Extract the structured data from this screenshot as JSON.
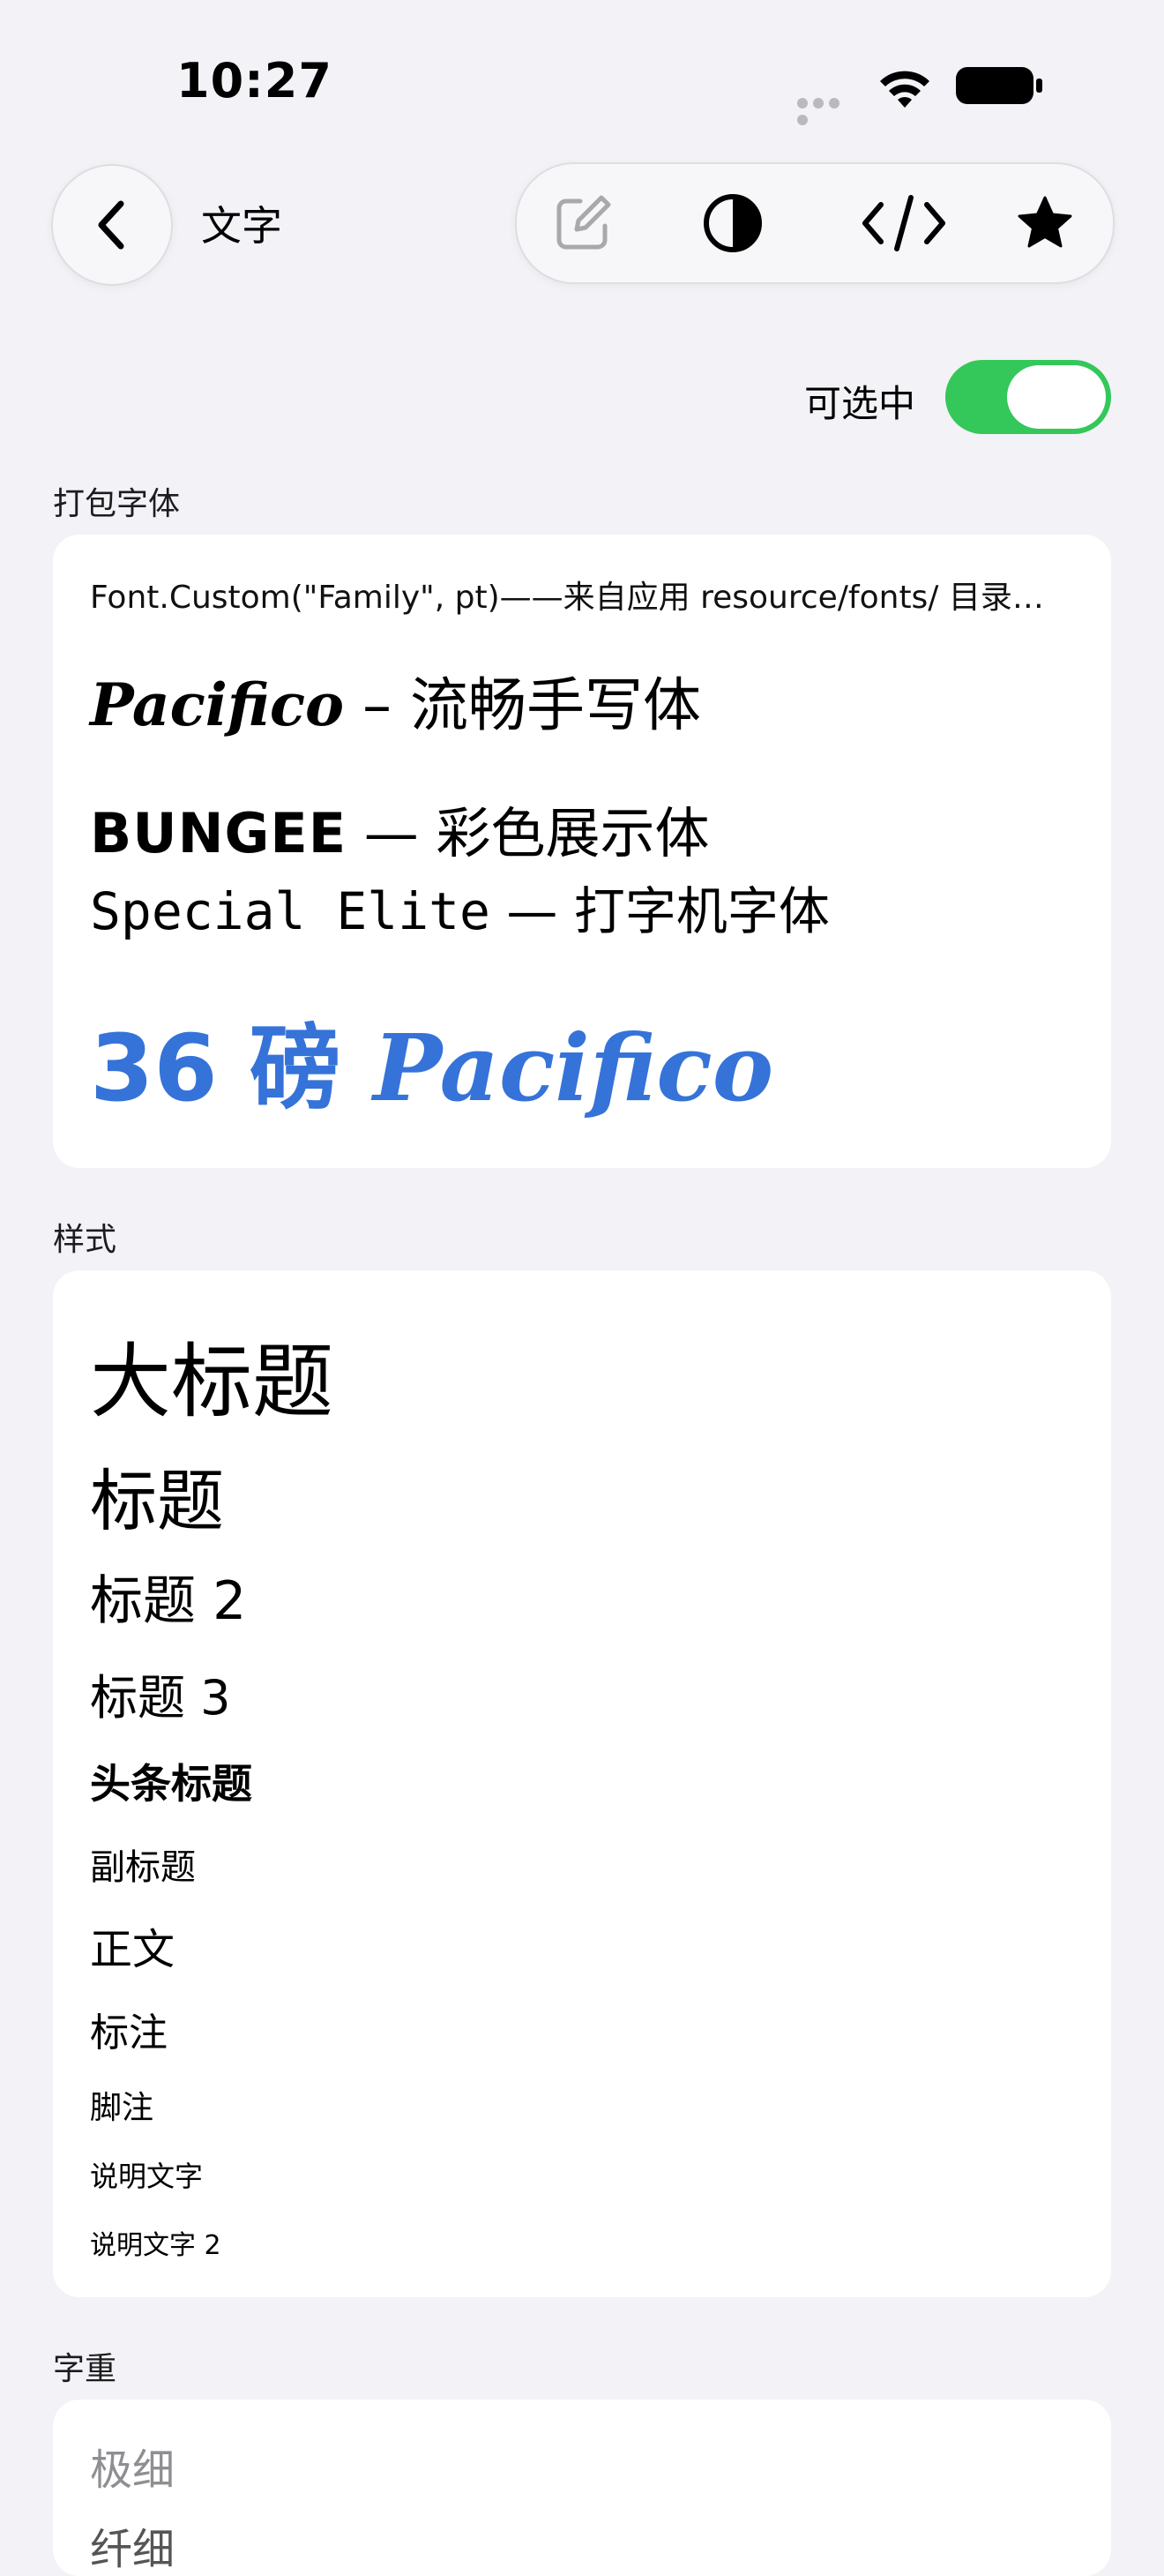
{
  "status_bar": {
    "time": "10:27"
  },
  "nav": {
    "title": "文字"
  },
  "toggle": {
    "label": "可选中",
    "on": true,
    "color": "#34c759"
  },
  "sections": {
    "bundled": "打包字体",
    "styles": "样式",
    "weights": "字重"
  },
  "bundled_fonts": {
    "caption": "Font.Custom(\"Family\", pt)——来自应用 resource/fonts/ 目录…",
    "pacifico_name": "Pacifico",
    "pacifico_desc": " – 流畅手写体",
    "bungee_name": "BUNGEE",
    "bungee_desc": " — 彩色展示体",
    "elite_name": "Special Elite",
    "elite_desc": " — 打字机字体",
    "big_prefix": "36 磅 ",
    "big_script": "Pacifico",
    "accent": "#3573d9"
  },
  "styles": {
    "large_title": "大标题",
    "title": "标题",
    "title2": "标题 2",
    "title3": "标题 3",
    "headline": "头条标题",
    "subheadline": "副标题",
    "body": "正文",
    "callout": "标注",
    "footnote": "脚注",
    "caption": "说明文字",
    "caption2": "说明文字 2"
  },
  "weights": {
    "ultralight": "极细",
    "thin": "纤细"
  }
}
